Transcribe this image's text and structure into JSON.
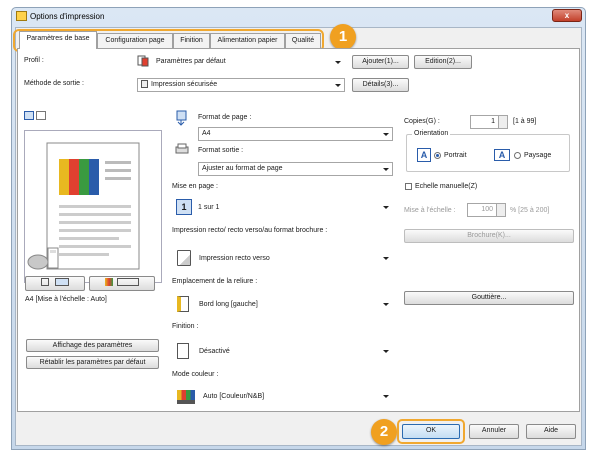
{
  "window": {
    "title": "Options d'impression",
    "close_label": "x"
  },
  "tabs": [
    {
      "label": "Paramètres de base",
      "active": true
    },
    {
      "label": "Configuration page",
      "active": false
    },
    {
      "label": "Finition",
      "active": false
    },
    {
      "label": "Alimentation papier",
      "active": false
    },
    {
      "label": "Qualité",
      "active": false
    }
  ],
  "badges": {
    "one": "1",
    "two": "2"
  },
  "profile": {
    "label": "Profil :",
    "value": "Paramètres par défaut",
    "add_button": "Ajouter(1)...",
    "edit_button": "Edition(2)..."
  },
  "output": {
    "label": "Méthode de sortie :",
    "value": "Impression sécurisée",
    "details_button": "Détails(3)..."
  },
  "preview": {
    "caption": "A4 [Mise à l'échelle : Auto]"
  },
  "left_buttons": {
    "view_settings": "Affichage des paramètres",
    "restore_defaults": "Rétablir les paramètres par défaut"
  },
  "page_size": {
    "label": "Format de page :",
    "value": "A4"
  },
  "output_size": {
    "label": "Format sortie :",
    "value": "Ajuster au format de page"
  },
  "layout": {
    "label": "Mise en page :",
    "icon_text": "1",
    "value": "1 sur 1"
  },
  "duplex": {
    "label": "Impression recto/ recto verso/au format brochure :",
    "value": "Impression recto verso"
  },
  "binding": {
    "label": "Emplacement de la reliure :",
    "value": "Bord long [gauche]"
  },
  "finishing": {
    "label": "Finition :",
    "value": "Désactivé"
  },
  "color_mode": {
    "label": "Mode couleur :",
    "value": "Auto [Couleur/N&B]"
  },
  "copies": {
    "label": "Copies(G) :",
    "value": "1",
    "range": "[1 à 99]"
  },
  "orientation": {
    "label": "Orientation",
    "portrait_icon": "A",
    "portrait": "Portrait",
    "landscape_icon": "A",
    "landscape": "Paysage"
  },
  "manual_scale": {
    "label": "Echelle manuelle(Z)",
    "field_label": "Mise à l'échelle :",
    "value": "100",
    "range": "% [25 à 200]"
  },
  "booklet_button": "Brochure(K)...",
  "gutter_button": "Gouttière...",
  "dialog_buttons": {
    "ok": "OK",
    "cancel": "Annuler",
    "help": "Aide"
  },
  "colors": {
    "highlight": "#f0a830",
    "badge": "#f0a020",
    "title_bar": "#dbe7f4"
  }
}
